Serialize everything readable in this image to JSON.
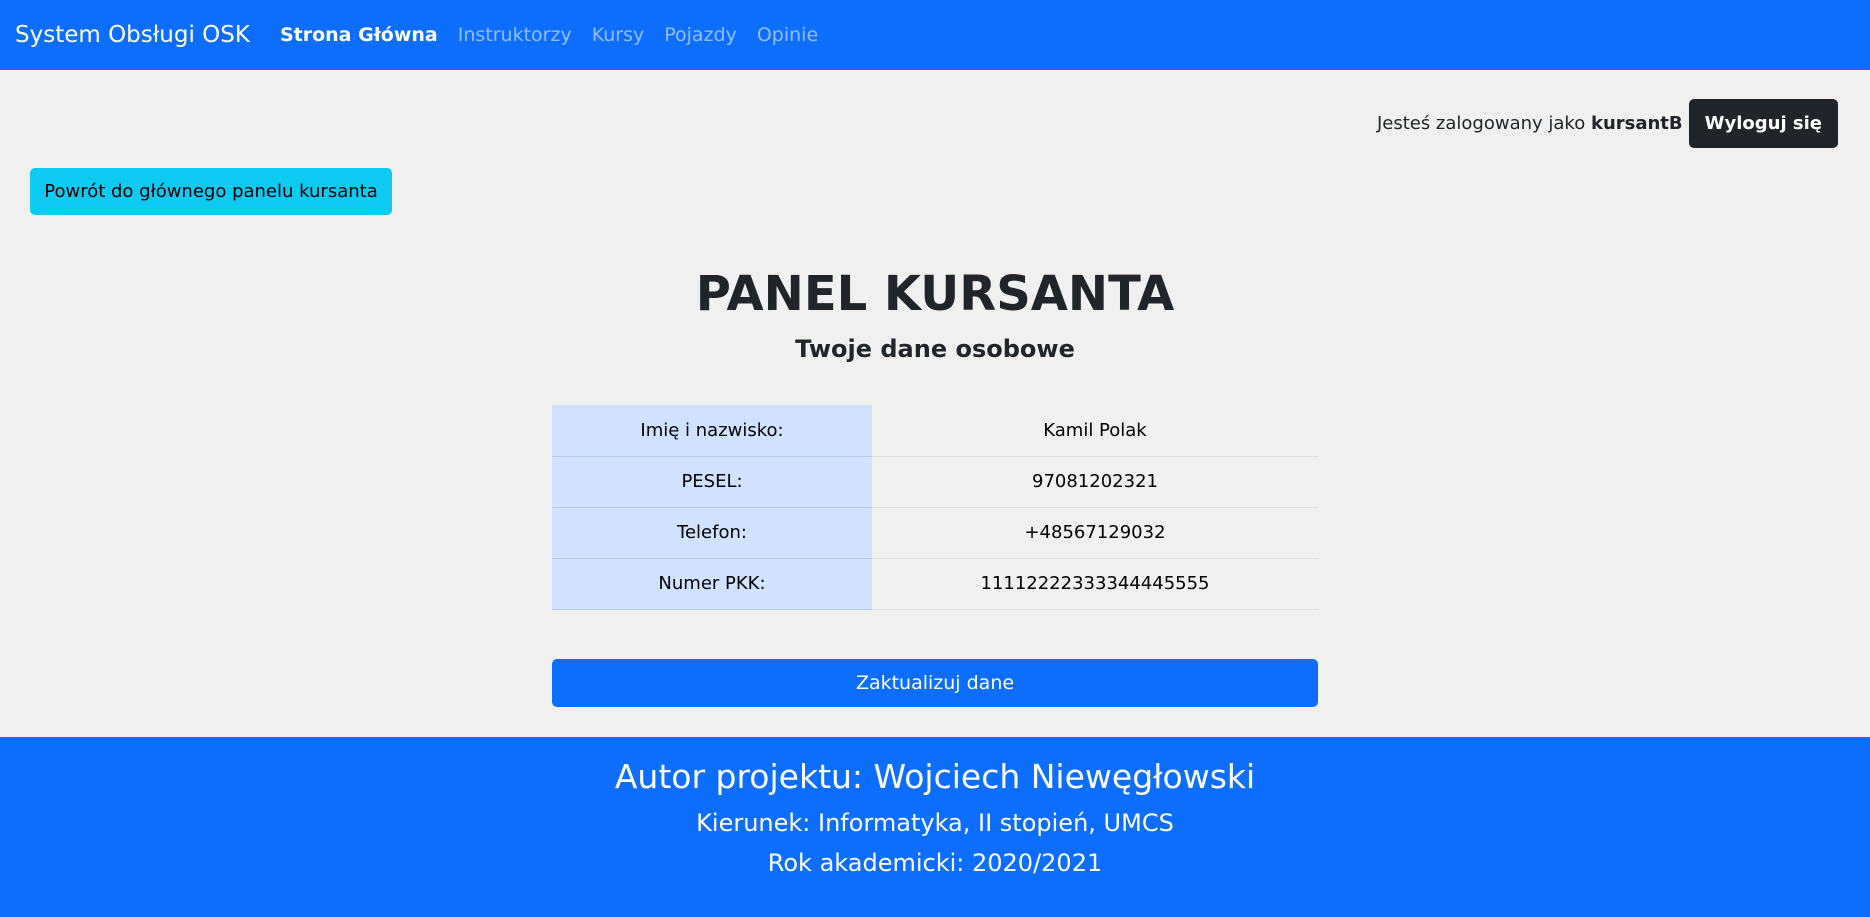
{
  "navbar": {
    "brand": "System Obsługi OSK",
    "links": [
      {
        "label": "Strona Główna",
        "active": true
      },
      {
        "label": "Instruktorzy",
        "active": false
      },
      {
        "label": "Kursy",
        "active": false
      },
      {
        "label": "Pojazdy",
        "active": false
      },
      {
        "label": "Opinie",
        "active": false
      }
    ]
  },
  "session": {
    "logged_in_text": "Jesteś zalogowany jako",
    "username": "kursantB",
    "logout_label": "Wyloguj się"
  },
  "back_button": "Powrót do głównego panelu kursanta",
  "main": {
    "title": "PANEL KURSANTA",
    "subtitle": "Twoje dane osobowe",
    "rows": [
      {
        "label": "Imię i nazwisko:",
        "value": "Kamil Polak"
      },
      {
        "label": "PESEL:",
        "value": "97081202321"
      },
      {
        "label": "Telefon:",
        "value": "+48567129032"
      },
      {
        "label": "Numer PKK:",
        "value": "11112222333344445555"
      }
    ],
    "update_button": "Zaktualizuj dane"
  },
  "footer": {
    "author": "Autor projektu: Wojciech Niewęgłowski",
    "field": "Kierunek: Informatyka, II stopień, UMCS",
    "year": "Rok akademicki: 2020/2021"
  },
  "colors": {
    "primary": "#0d6efd",
    "info": "#0dcaf0",
    "dark": "#212529",
    "table_label_bg": "#cfe2ff",
    "page_bg": "#f0f0f0"
  }
}
